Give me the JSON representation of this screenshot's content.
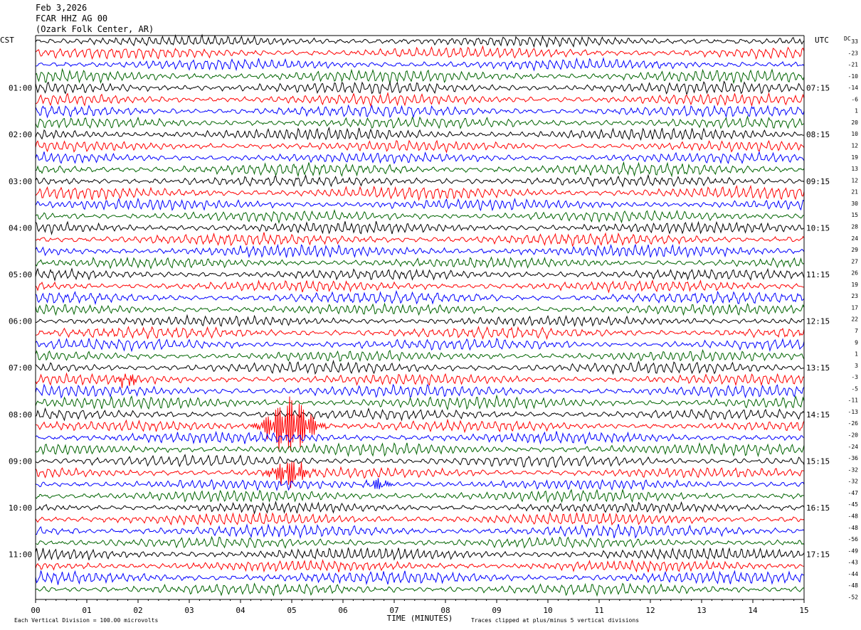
{
  "header": {
    "date": "Feb 3,2026",
    "station": "FCAR HHZ AG 00",
    "location": "(Ozark Folk Center, AR)"
  },
  "chart_data": {
    "type": "line",
    "title": "Feb 3,2026",
    "xlabel": "TIME (MINUTES)",
    "x_ticks": [
      "00",
      "01",
      "02",
      "03",
      "04",
      "05",
      "06",
      "07",
      "08",
      "09",
      "10",
      "11",
      "12",
      "13",
      "14",
      "15"
    ],
    "xlim": [
      0,
      15
    ],
    "left_axis_label": "CST",
    "right_axis_label": "UTC",
    "dc_label": "DC",
    "left_time_labels": [
      {
        "row": 4,
        "label": "01:00"
      },
      {
        "row": 8,
        "label": "02:00"
      },
      {
        "row": 12,
        "label": "03:00"
      },
      {
        "row": 16,
        "label": "04:00"
      },
      {
        "row": 20,
        "label": "05:00"
      },
      {
        "row": 24,
        "label": "06:00"
      },
      {
        "row": 28,
        "label": "07:00"
      },
      {
        "row": 32,
        "label": "08:00"
      },
      {
        "row": 36,
        "label": "09:00"
      },
      {
        "row": 40,
        "label": "10:00"
      },
      {
        "row": 44,
        "label": "11:00"
      }
    ],
    "right_time_labels": [
      {
        "row": 4,
        "label": "07:15"
      },
      {
        "row": 8,
        "label": "08:15"
      },
      {
        "row": 12,
        "label": "09:15"
      },
      {
        "row": 16,
        "label": "10:15"
      },
      {
        "row": 20,
        "label": "11:15"
      },
      {
        "row": 24,
        "label": "12:15"
      },
      {
        "row": 28,
        "label": "13:15"
      },
      {
        "row": 32,
        "label": "14:15"
      },
      {
        "row": 36,
        "label": "15:15"
      },
      {
        "row": 40,
        "label": "16:15"
      },
      {
        "row": 44,
        "label": "17:15"
      }
    ],
    "dc_offsets": [
      33,
      -23,
      -21,
      -10,
      -14,
      -6,
      1,
      20,
      10,
      12,
      19,
      13,
      12,
      21,
      30,
      15,
      28,
      24,
      29,
      27,
      26,
      19,
      23,
      17,
      22,
      7,
      9,
      1,
      3,
      -3,
      -5,
      -11,
      -13,
      -26,
      -20,
      -24,
      -36,
      -32,
      -32,
      -47,
      -45,
      -48,
      -48,
      -56,
      -49,
      -43,
      -44,
      -48,
      -52
    ],
    "trace_colors": [
      "#000000",
      "#ff0000",
      "#0000ff",
      "#006400"
    ],
    "row_count": 48,
    "events": [
      {
        "row": 29,
        "minute": 1.8,
        "amplitude": "small"
      },
      {
        "row": 33,
        "minute": 4.95,
        "amplitude": "large"
      },
      {
        "row": 37,
        "minute": 4.95,
        "amplitude": "medium"
      },
      {
        "row": 38,
        "minute": 6.7,
        "amplitude": "small"
      }
    ],
    "footer_left": "Each Vertical Division =  100.00 microvolts",
    "footer_right": "Traces clipped at plus/minus 5 vertical divisions"
  }
}
